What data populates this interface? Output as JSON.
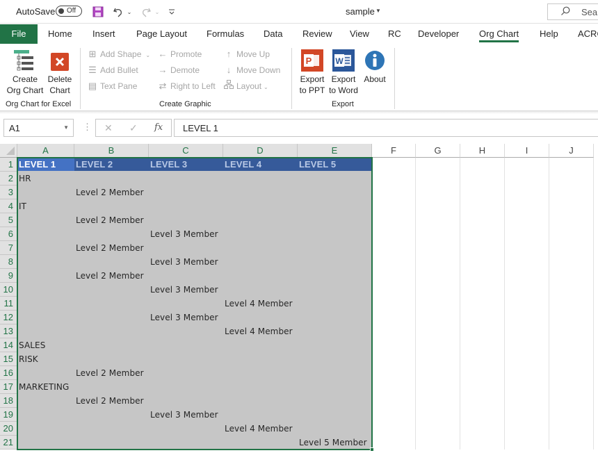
{
  "titlebar": {
    "autosave_label": "AutoSave",
    "autosave_state": "Off",
    "quick_access": [
      "save-icon",
      "undo-icon",
      "redo-icon",
      "customize-icon"
    ],
    "document_title": "sample",
    "search_placeholder": "Search"
  },
  "tabs": [
    {
      "label": "File",
      "active": false
    },
    {
      "label": "Home",
      "active": false
    },
    {
      "label": "Insert",
      "active": false
    },
    {
      "label": "Page Layout",
      "active": false
    },
    {
      "label": "Formulas",
      "active": false
    },
    {
      "label": "Data",
      "active": false
    },
    {
      "label": "Review",
      "active": false
    },
    {
      "label": "View",
      "active": false
    },
    {
      "label": "RC",
      "active": false
    },
    {
      "label": "Developer",
      "active": false
    },
    {
      "label": "Org Chart",
      "active": true
    },
    {
      "label": "Help",
      "active": false
    },
    {
      "label": "ACROBAT",
      "active": false
    }
  ],
  "ribbon": {
    "groups": {
      "org_chart_for_excel": {
        "label": "Org Chart for Excel",
        "create_line1": "Create",
        "create_line2": "Org Chart",
        "delete_line1": "Delete",
        "delete_line2": "Chart"
      },
      "create_graphic": {
        "label": "Create Graphic",
        "add_shape": "Add Shape",
        "add_bullet": "Add Bullet",
        "text_pane": "Text Pane",
        "promote": "Promote",
        "demote": "Demote",
        "right_to_left": "Right to Left",
        "move_up": "Move Up",
        "move_down": "Move Down",
        "layout": "Layout"
      },
      "export": {
        "label": "Export",
        "ppt_line1": "Export",
        "ppt_line2": "to PPT",
        "word_line1": "Export",
        "word_line2": "to Word",
        "about": "About"
      }
    },
    "colors": {
      "ppt": "#d24726",
      "word": "#2b579a",
      "about": "#2e75b6",
      "delete": "#d24726",
      "accent": "#217346"
    }
  },
  "formula_bar": {
    "name_box": "A1",
    "cancel_icon": "✕",
    "enter_icon": "✓",
    "fx_label": "fx",
    "formula": "LEVEL 1"
  },
  "sheet": {
    "columns": [
      "A",
      "B",
      "C",
      "D",
      "E",
      "F",
      "G",
      "H",
      "I",
      "J"
    ],
    "rows": [
      "1",
      "2",
      "3",
      "4",
      "5",
      "6",
      "7",
      "8",
      "9",
      "10",
      "11",
      "12",
      "13",
      "14",
      "15",
      "16",
      "17",
      "18",
      "19",
      "20",
      "21"
    ],
    "header_row": [
      "LEVEL 1",
      "LEVEL 2",
      "LEVEL 3",
      "LEVEL 4",
      "LEVEL 5"
    ],
    "cells": [
      {
        "row": 2,
        "col": 0,
        "value": "HR"
      },
      {
        "row": 3,
        "col": 1,
        "value": "Level 2 Member"
      },
      {
        "row": 4,
        "col": 0,
        "value": "IT"
      },
      {
        "row": 5,
        "col": 1,
        "value": "Level 2 Member"
      },
      {
        "row": 6,
        "col": 2,
        "value": "Level 3 Member"
      },
      {
        "row": 7,
        "col": 1,
        "value": "Level 2 Member"
      },
      {
        "row": 8,
        "col": 2,
        "value": "Level 3 Member"
      },
      {
        "row": 9,
        "col": 1,
        "value": "Level 2 Member"
      },
      {
        "row": 10,
        "col": 2,
        "value": "Level 3 Member"
      },
      {
        "row": 11,
        "col": 3,
        "value": "Level 4 Member"
      },
      {
        "row": 12,
        "col": 2,
        "value": "Level 3 Member"
      },
      {
        "row": 13,
        "col": 3,
        "value": "Level 4 Member"
      },
      {
        "row": 14,
        "col": 0,
        "value": "SALES"
      },
      {
        "row": 15,
        "col": 0,
        "value": "RISK"
      },
      {
        "row": 16,
        "col": 1,
        "value": "Level 2 Member"
      },
      {
        "row": 17,
        "col": 0,
        "value": "MARKETING"
      },
      {
        "row": 18,
        "col": 1,
        "value": "Level 2 Member"
      },
      {
        "row": 19,
        "col": 2,
        "value": "Level 3 Member"
      },
      {
        "row": 20,
        "col": 3,
        "value": "Level 4 Member"
      },
      {
        "row": 21,
        "col": 4,
        "value": "Level 5 Member"
      }
    ],
    "active_cell": "A1",
    "selection": "A1:E21",
    "colors": {
      "header_fill": "#365a9a",
      "active_header_fill": "#4472c4",
      "selection_fill": "#c6c6c6",
      "selection_border": "#217346"
    }
  }
}
